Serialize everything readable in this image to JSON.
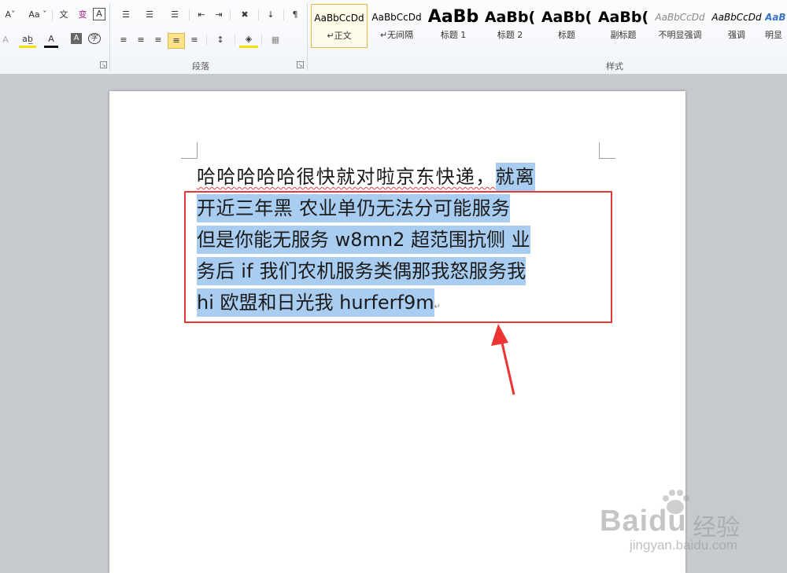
{
  "ribbon": {
    "font_group": {
      "row1": [
        "Aˇ",
        "Aa ˇ",
        "文",
        "变",
        "A"
      ],
      "row2": [
        "A",
        "ab̲",
        "A",
        "A",
        "字"
      ]
    },
    "paragraph_group": {
      "label": "段落",
      "row1": [
        "☰",
        "☰",
        "☰",
        "⇤",
        "⇥",
        "✖",
        "↓",
        "¶"
      ],
      "row2": [
        "≡",
        "≡",
        "≡",
        "≡",
        "≡",
        "↕",
        "◈",
        "▦"
      ]
    },
    "styles_group": {
      "label": "样式",
      "items": [
        {
          "preview": "AaBbCcDd",
          "name": "↵正文"
        },
        {
          "preview": "AaBbCcDd",
          "name": "↵无间隔"
        },
        {
          "preview": "AaBb",
          "name": "标题 1"
        },
        {
          "preview": "AaBb(",
          "name": "标题 2"
        },
        {
          "preview": "AaBb(",
          "name": "标题"
        },
        {
          "preview": "AaBb(",
          "name": "副标题"
        },
        {
          "preview": "AaBbCcDd",
          "name": "不明显强调"
        },
        {
          "preview": "AaBbCcDd",
          "name": "强调"
        },
        {
          "preview": "AaB",
          "name": "明显"
        }
      ],
      "selected_index": 0
    }
  },
  "document": {
    "lines": [
      {
        "plain": "哈哈哈哈哈很快就对啦京东快递，",
        "selected": "就离"
      },
      {
        "selected": "开近三年黑 农业单仍无法分可能服务"
      },
      {
        "selected": "但是你能无服务 w8mn2 超范围抗侧 业"
      },
      {
        "selected": "务后 if 我们农机服务类偶那我怒服务我"
      },
      {
        "selected": "hi 欧盟和日光我 hurferf9m",
        "paragraph_mark": "↵"
      }
    ]
  },
  "watermark": {
    "brand": "Bai",
    "brand2": "du",
    "cn": "经验",
    "url": "jingyan.baidu.com"
  },
  "colors": {
    "selection": "#a8cdf0",
    "annotation_red": "#e33b3b",
    "highlight_button": "#ffe38c",
    "workspace": "#c6cacf"
  }
}
